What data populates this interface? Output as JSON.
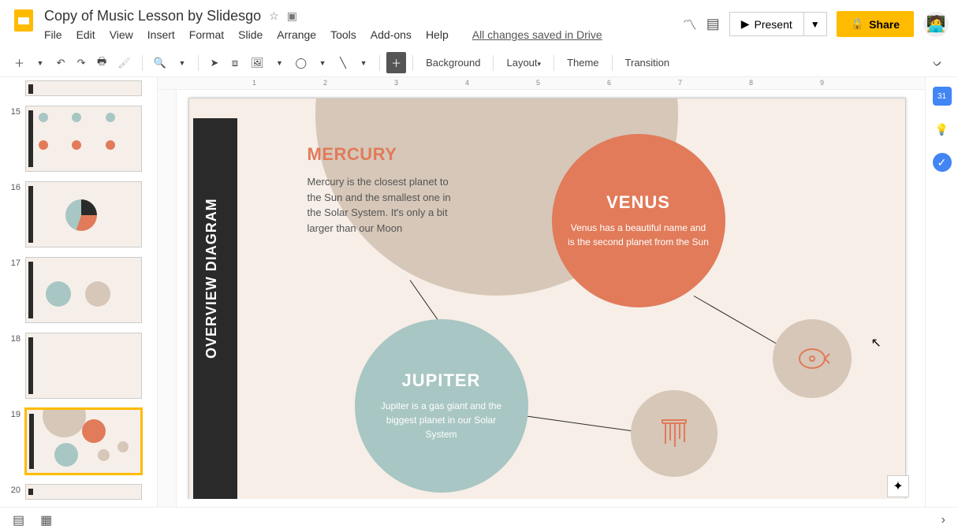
{
  "app": {
    "title": "Copy of Music Lesson by Slidesgo",
    "save_status": "All changes saved in Drive"
  },
  "menu": {
    "file": "File",
    "edit": "Edit",
    "view": "View",
    "insert": "Insert",
    "format": "Format",
    "slide": "Slide",
    "arrange": "Arrange",
    "tools": "Tools",
    "addons": "Add-ons",
    "help": "Help"
  },
  "header": {
    "present": "Present",
    "share": "Share"
  },
  "toolbar": {
    "background": "Background",
    "layout": "Layout",
    "theme": "Theme",
    "transition": "Transition"
  },
  "thumbs": {
    "n15": "15",
    "n16": "16",
    "n17": "17",
    "n18": "18",
    "n19": "19",
    "n20": "20"
  },
  "ruler": {
    "t1": "1",
    "t2": "2",
    "t3": "3",
    "t4": "4",
    "t5": "5",
    "t6": "6",
    "t7": "7",
    "t8": "8",
    "t9": "9"
  },
  "slide": {
    "sidebar_title": "OVERVIEW DIAGRAM",
    "mercury": {
      "title": "MERCURY",
      "desc": "Mercury is the closest planet to the Sun and the smallest one in the Solar System. It's only a bit larger than our Moon"
    },
    "venus": {
      "title": "VENUS",
      "desc": "Venus has a beautiful name and is the second planet from the Sun"
    },
    "jupiter": {
      "title": "JUPITER",
      "desc": "Jupiter is a gas giant and the biggest planet in our Solar System"
    }
  }
}
